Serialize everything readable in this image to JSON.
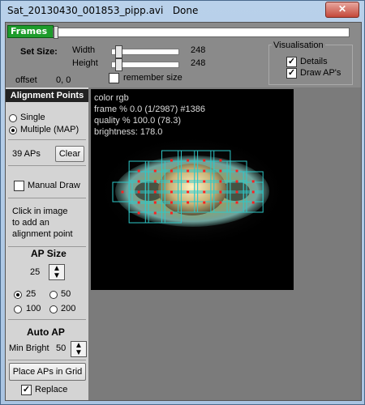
{
  "window": {
    "title": "Sat_20130430_001853_pipp.avi",
    "status": "Done",
    "close_glyph": "✕"
  },
  "frames": {
    "label": "Frames",
    "position_fraction": 0.0
  },
  "set_size": {
    "label": "Set Size:",
    "width_label": "Width",
    "width_value": "248",
    "height_label": "Height",
    "height_value": "248",
    "remember_label": "remember size",
    "remember_checked": false
  },
  "offset": {
    "label": "offset",
    "value": "0, 0"
  },
  "visualisation": {
    "title": "Visualisation",
    "details_label": "Details",
    "details_checked": true,
    "draw_aps_label": "Draw AP's",
    "draw_aps_checked": true
  },
  "alignment": {
    "header": "Alignment Points",
    "single_label": "Single",
    "multiple_label": "Multiple (MAP)",
    "mode": "multiple",
    "ap_count": "39 APs",
    "clear_label": "Clear",
    "manual_draw_label": "Manual Draw",
    "manual_draw_checked": false,
    "hint_line1": "Click in image",
    "hint_line2": "to add an",
    "hint_line3": "alignment point"
  },
  "ap_size": {
    "header": "AP Size",
    "value": "25",
    "opt_25": "25",
    "opt_50": "50",
    "opt_100": "100",
    "opt_200": "200",
    "selected": "25"
  },
  "auto_ap": {
    "header": "Auto AP",
    "min_bright_label": "Min Bright",
    "min_bright_value": "50",
    "place_button": "Place APs in Grid",
    "replace_label": "Replace",
    "replace_checked": true
  },
  "image_info": {
    "color": "color rgb",
    "frame": "frame % 0.0 (1/2987) #1386",
    "quality": "quality % 100.0  (78.3)",
    "brightness": "brightness: 178.0"
  },
  "colors": {
    "ap_box": "#2ec9c9",
    "ap_point": "#ff2020",
    "frames_label_bg": "#1d9c2b"
  }
}
